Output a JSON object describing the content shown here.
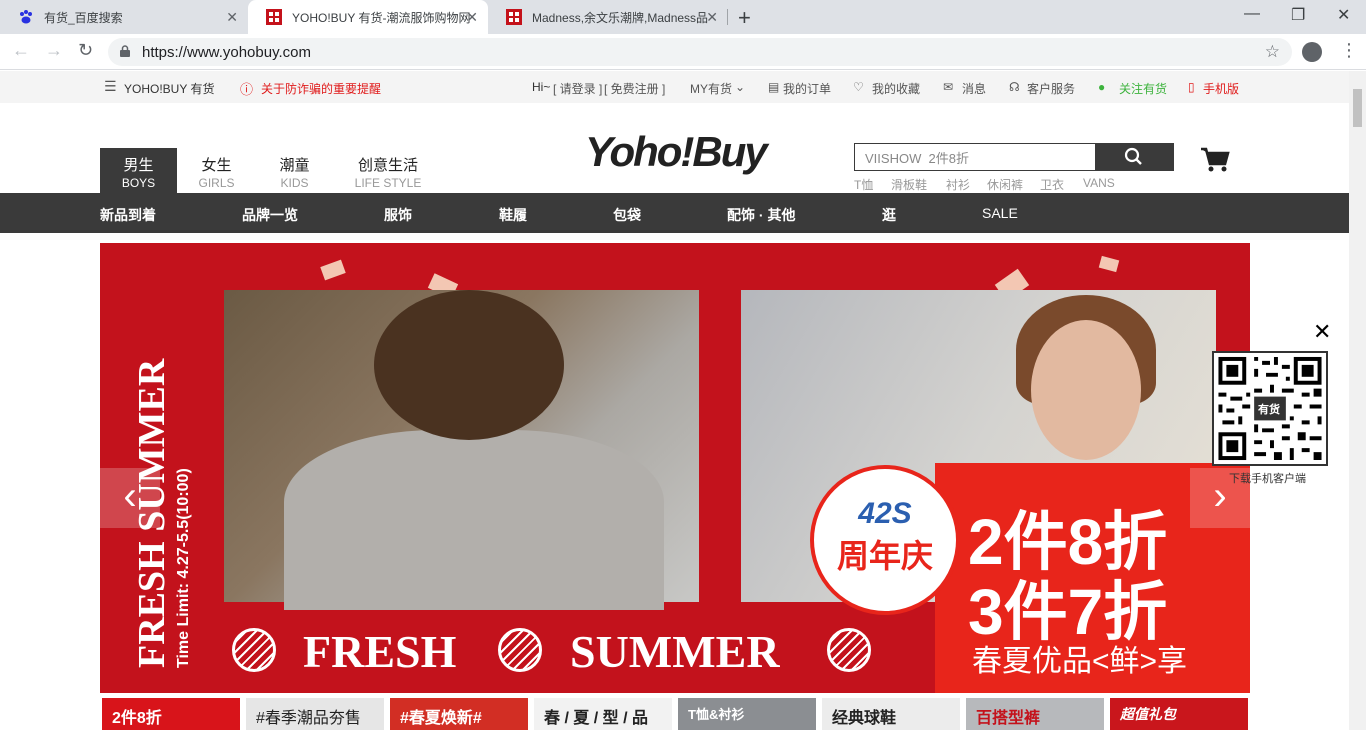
{
  "browser": {
    "tabs": [
      {
        "title": "有货_百度搜索",
        "active": false
      },
      {
        "title": "YOHO!BUY 有货-潮流服饰购物网",
        "active": true
      },
      {
        "title": "Madness,余文乐潮牌,Madness品",
        "active": false
      }
    ],
    "url": "https://www.yohobuy.com"
  },
  "topbar": {
    "brand": "YOHO!BUY 有货",
    "warning": "关于防诈骗的重要提醒",
    "hi": "Hi~",
    "login": "[ 请登录 ]",
    "register": "[ 免费注册 ]",
    "my": "MY有货",
    "orders": "我的订单",
    "favorites": "我的收藏",
    "messages": "消息",
    "service": "客户服务",
    "follow": "关注有货",
    "mobile": "手机版"
  },
  "genders": [
    {
      "cn": "男生",
      "en": "BOYS"
    },
    {
      "cn": "女生",
      "en": "GIRLS"
    },
    {
      "cn": "潮童",
      "en": "KIDS"
    },
    {
      "cn": "创意生活",
      "en": "LIFE STYLE"
    }
  ],
  "logo": "Yoho!Buy",
  "search": {
    "value": "VIISHOW  2件8折"
  },
  "hotwords": [
    "T恤",
    "滑板鞋",
    "衬衫",
    "休闲裤",
    "卫衣",
    "VANS"
  ],
  "nav": [
    "新品到着",
    "品牌一览",
    "服饰",
    "鞋履",
    "包袋",
    "配饰 · 其他",
    "逛",
    "SALE"
  ],
  "banner": {
    "vertical_title": "FRESH SUMMER",
    "vertical_sub": "Time Limit:  4.27-5.5(10:00)",
    "bottom_left": "FRESH",
    "bottom_right": "SUMMER",
    "badge_num": "42S",
    "badge_cn": "周年庆",
    "promo1": "2件8折",
    "promo2": "3件7折",
    "promo3": "春夏优品<鲜>享"
  },
  "qr": {
    "caption": "下载手机客户端",
    "center": "有货"
  },
  "tiles": [
    "2件8折",
    "#春季潮品夯售",
    "#春夏焕新#",
    "春 / 夏 / 型 / 品",
    "T恤&衬衫",
    "经典球鞋",
    "百搭型裤",
    "超值礼包"
  ]
}
